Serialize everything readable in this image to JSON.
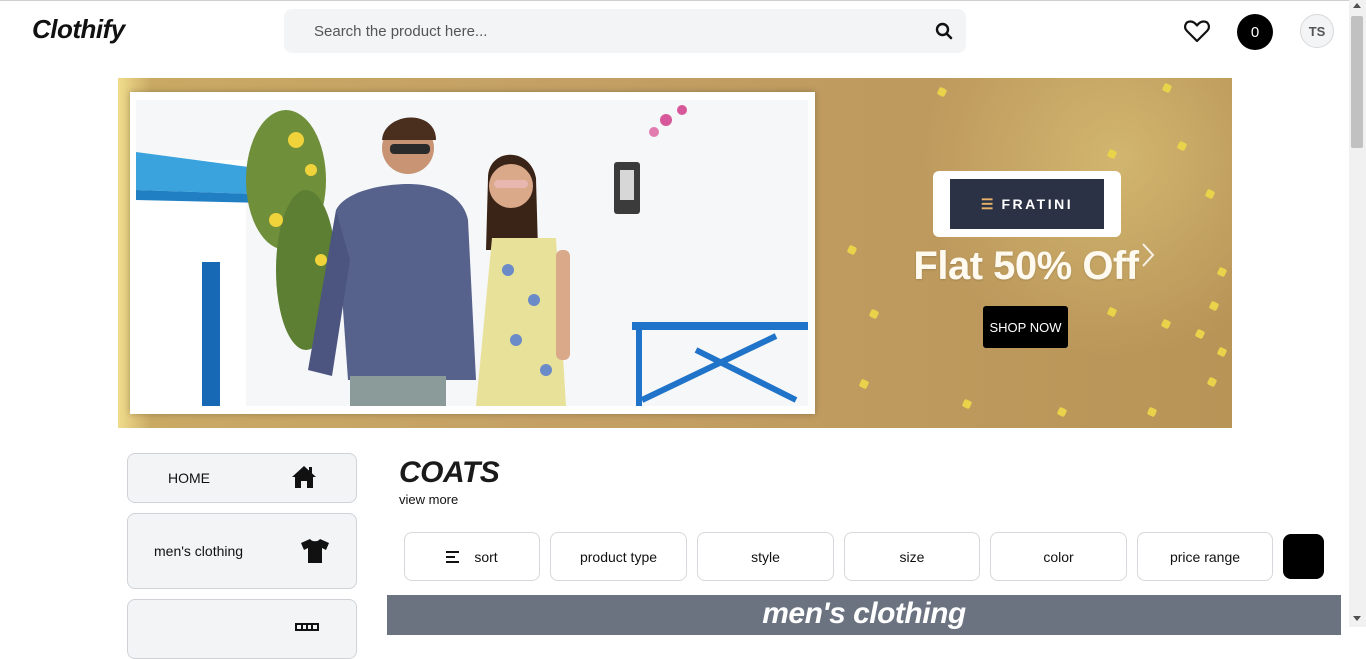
{
  "header": {
    "logo": "Clothify",
    "search": {
      "placeholder": "Search the product here..."
    },
    "cart_count": "0",
    "avatar_initials": "TS"
  },
  "banner": {
    "brand": "FRATINI",
    "offer": "Flat 50% Off",
    "cta": "SHOP NOW"
  },
  "sidebar": {
    "items": [
      {
        "label": "HOME",
        "icon": "home-icon"
      },
      {
        "label": "men's clothing",
        "icon": "tshirt-icon"
      },
      {
        "label": "",
        "icon": "store-icon"
      }
    ]
  },
  "section": {
    "title": "COATS",
    "view_more": "view more",
    "filters": [
      "sort",
      "product type",
      "style",
      "size",
      "color",
      "price range"
    ],
    "category_banner": "men's clothing"
  },
  "colors": {
    "accent": "#000000",
    "banner_gold": "#c4a065",
    "category_bar": "#6b7280",
    "surface": "#f3f4f6"
  }
}
